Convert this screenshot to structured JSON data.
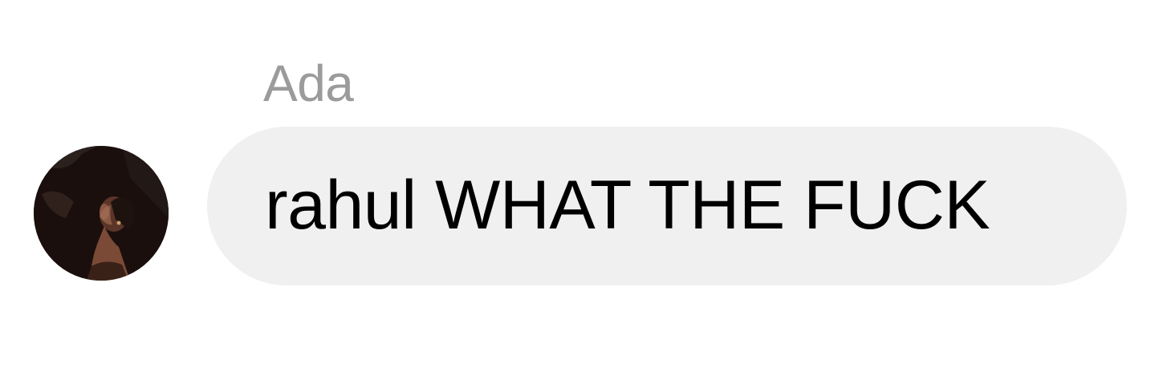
{
  "message": {
    "sender_name": "Ada",
    "text": "rahul WHAT THE FUCK",
    "bubble_color": "#f0f0f0",
    "sender_color": "#9b9b9b",
    "avatar_icon": "user-avatar-photo"
  }
}
